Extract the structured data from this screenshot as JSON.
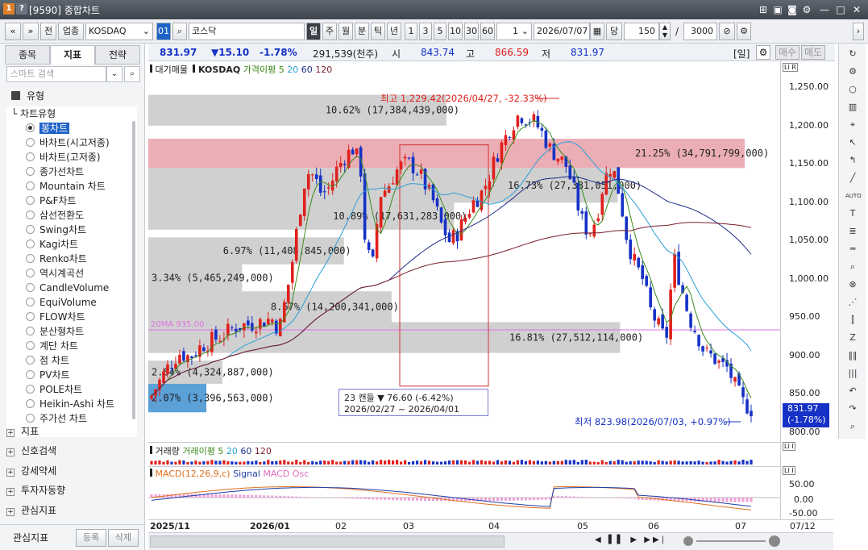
{
  "window": {
    "title": "[9590] 종합차트",
    "badge1": "1",
    "badge2": "?"
  },
  "toolbar": {
    "prev": "«",
    "next": "»",
    "btn_jeon": "전",
    "btn_upjong": "업종",
    "symbol": "KOSDAQ",
    "code_btn": "01",
    "name": "코스닥",
    "periods": [
      "일",
      "주",
      "월",
      "분",
      "틱",
      "년"
    ],
    "selected_period": "일",
    "intervals": [
      "1",
      "3",
      "5",
      "10",
      "30",
      "60"
    ],
    "count_value": "1",
    "date": "2026/07/07",
    "dang_label": "당",
    "bars_value": "150",
    "slash": "/",
    "total_value": "3000"
  },
  "left_panel": {
    "tabs": [
      "종목",
      "지표",
      "전략"
    ],
    "active_tab": "지표",
    "search_placeholder": "스마트 검색",
    "type_header": "유형",
    "chart_type_header": "차트유형",
    "chart_types": [
      "봉차트",
      "바차트(시고저종)",
      "바차트(고저종)",
      "종가선차트",
      "Mountain 차트",
      "P&F차트",
      "삼선전환도",
      "Swing차트",
      "Kagi차트",
      "Renko차트",
      "역시계곡선",
      "CandleVolume",
      "EquiVolume",
      "FLOW차트",
      "분산형차트",
      "계단 차트",
      "점 차트",
      "PV차트",
      "POLE차트",
      "Heikin-Ashi 차트",
      "주가선 차트"
    ],
    "selected_type": "봉차트",
    "categories": [
      "지표",
      "신호검색",
      "강세약세",
      "투자자동향",
      "관심지표"
    ],
    "footer_label": "관심지표",
    "register_btn": "등록",
    "delete_btn": "삭제"
  },
  "quote": {
    "price": "831.97",
    "change": "▼15.10",
    "change_pct": "-1.78%",
    "volume": "291,539(천주)",
    "open_label": "시",
    "open": "843.74",
    "high_label": "고",
    "high": "866.59",
    "low_label": "저",
    "low": "831.97",
    "period_tag": "[일]",
    "buy_btn": "매수",
    "sell_btn": "매도"
  },
  "legend": {
    "item1": "대기매물",
    "item2": "KOSDAQ",
    "ma_price": "가격이평 5",
    "ma20": "20",
    "ma60": "60",
    "ma120": "120"
  },
  "annotations": {
    "high": "최고 1,229.42(2026/04/27, -32.33%)",
    "low": "최저 823.98(2026/07/03, +0.97%)",
    "range_box_line1": "23 캔들  ▼ 76.60 (-6.42%)",
    "range_box_line2": "2026/02/27 ~ 2026/04/01",
    "price_tag_value": "831.97",
    "price_tag_pct": "(-1.78%)",
    "pink_line_label": "20MA 935.00"
  },
  "volume_profile": [
    {
      "label": "10.62% (17,384,439,000)",
      "pct": 10.62
    },
    {
      "label": "21.25% (34,791,799,000)",
      "pct": 21.25
    },
    {
      "label": "16.73% (27,381,051,000)",
      "pct": 16.73
    },
    {
      "label": "10.89% (17,631,283,000)",
      "pct": 10.89
    },
    {
      "label": "6.97% (11,408,845,000)",
      "pct": 6.97
    },
    {
      "label": "3.34% (5,465,249,000)",
      "pct": 3.34
    },
    {
      "label": "8.67% (14,200,341,000)",
      "pct": 8.67
    },
    {
      "label": "16.81% (27,512,114,000)",
      "pct": 16.81
    },
    {
      "label": "2.64% (4,324,887,000)",
      "pct": 2.64
    },
    {
      "label": "2.07% (3,396,563,000)",
      "pct": 2.07
    }
  ],
  "y_axis": [
    "1,250.00",
    "1,200.00",
    "1,150.00",
    "1,100.00",
    "1,050.00",
    "1,000.00",
    "950.00",
    "900.00",
    "850.00",
    "800.00"
  ],
  "volume_panel": {
    "title": "거래량",
    "ma": "거래이평 5",
    "ma20": "20",
    "ma60": "60",
    "ma120": "120"
  },
  "macd_panel": {
    "title": "MACD(12,26,9,c)",
    "signal": "Signal",
    "osc": "MACD Osc",
    "y_axis": [
      "50.00",
      "0.00",
      "-50.00"
    ]
  },
  "x_axis": [
    "2025/11",
    "2026/01",
    "02",
    "03",
    "04",
    "05",
    "06",
    "07",
    "07/12"
  ],
  "colors": {
    "up": "#e0201c",
    "down": "#1531c6",
    "ma5": "#3a8a1a",
    "ma20": "#2aa0d8",
    "ma60": "#1f2e8a",
    "ma120": "#7a1e2a",
    "profile_gray": "#c8c8c8",
    "profile_max": "#e8a0a8",
    "profile_current": "#3e8fd0"
  }
}
